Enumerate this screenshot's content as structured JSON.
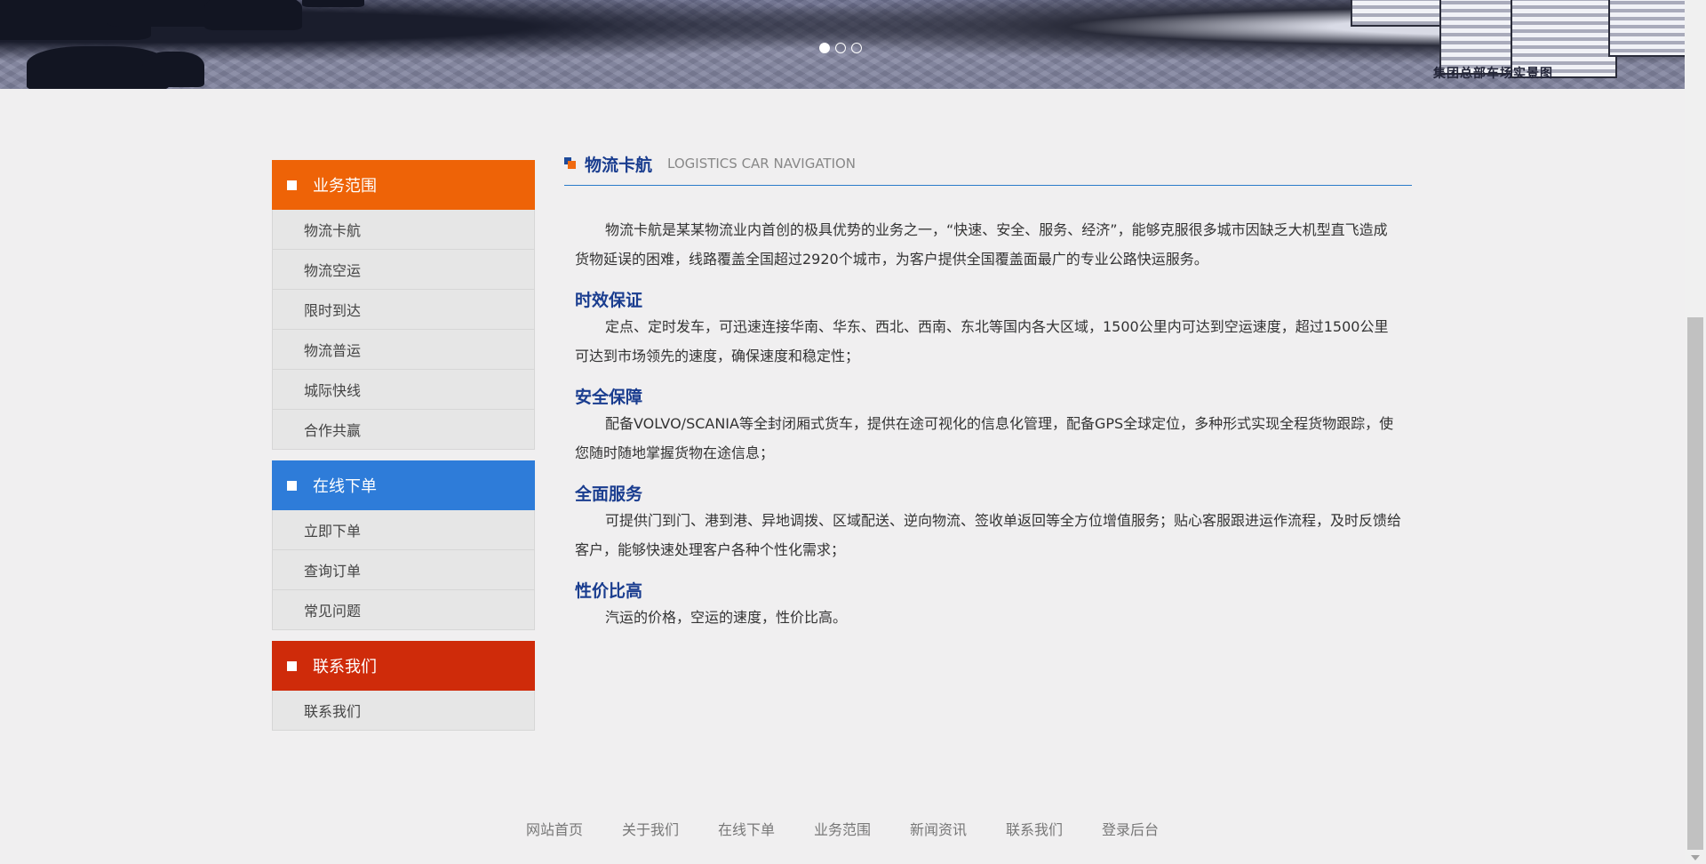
{
  "banner": {
    "caption": "集团总部车场实景图",
    "dots": [
      true,
      false,
      false
    ]
  },
  "sidebar": {
    "sections": [
      {
        "title": "业务范围",
        "color": "#ee6307",
        "items": [
          "物流卡航",
          "物流空运",
          "限时到达",
          "物流普运",
          "城际快线",
          "合作共赢"
        ]
      },
      {
        "title": "在线下单",
        "color": "#2e7cd9",
        "items": [
          "立即下单",
          "查询订单",
          "常见问题"
        ]
      },
      {
        "title": "联系我们",
        "color": "#cf2b0a",
        "items": [
          "联系我们"
        ]
      }
    ]
  },
  "main": {
    "title_cn": "物流卡航",
    "title_en": "LOGISTICS CAR NAVIGATION",
    "intro": "物流卡航是某某物流业内首创的极具优势的业务之一，“快速、安全、服务、经济”，能够克服很多城市因缺乏大机型直飞造成货物延误的困难，线路覆盖全国超过2920个城市，为客户提供全国覆盖面最广的专业公路快运服务。",
    "sections": [
      {
        "heading": "时效保证",
        "text": "定点、定时发车，可迅速连接华南、华东、西北、西南、东北等国内各大区域，1500公里内可达到空运速度，超过1500公里可达到市场领先的速度，确保速度和稳定性；"
      },
      {
        "heading": "安全保障",
        "text": "配备VOLVO/SCANIA等全封闭厢式货车，提供在途可视化的信息化管理，配备GPS全球定位，多种形式实现全程货物跟踪，使您随时随地掌握货物在途信息；"
      },
      {
        "heading": "全面服务",
        "text": "可提供门到门、港到港、异地调拨、区域配送、逆向物流、签收单返回等全方位增值服务；贴心客服跟进运作流程，及时反馈给客户，能够快速处理客户各种个性化需求；"
      },
      {
        "heading": "性价比高",
        "text": "汽运的价格，空运的速度，性价比高。"
      }
    ]
  },
  "footer": {
    "links": [
      "网站首页",
      "关于我们",
      "在线下单",
      "业务范围",
      "新闻资讯",
      "联系我们",
      "登录后台"
    ]
  }
}
